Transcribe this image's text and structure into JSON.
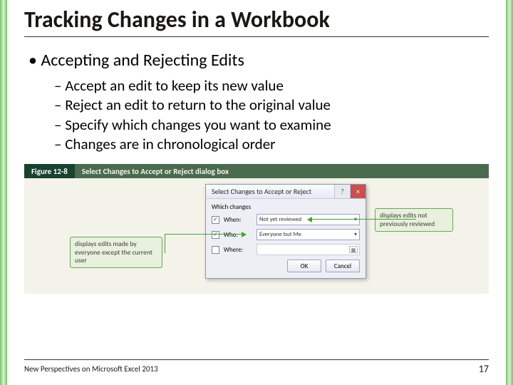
{
  "title": "Tracking Changes in a Workbook",
  "bullets": {
    "l1": "Accepting and Rejecting Edits",
    "l2a": "Accept an edit to keep its new value",
    "l2b": "Reject an edit to return to the original value",
    "l2c": "Specify which changes you want to examine",
    "l2d": "Changes are in chronological order"
  },
  "figure": {
    "num": "Figure 12-8",
    "caption": "Select Changes to Accept or Reject dialog box"
  },
  "dialog": {
    "title": "Select Changes to Accept or Reject",
    "help": "?",
    "close": "×",
    "which": "Which changes",
    "when_label": "When:",
    "when_value": "Not yet reviewed",
    "who_label": "Who:",
    "who_value": "Everyone but Me",
    "where_label": "Where:",
    "ok": "OK",
    "cancel": "Cancel"
  },
  "callouts": {
    "left": "displays edits made by everyone except the current user",
    "right": "displays edits not previously reviewed"
  },
  "footer": {
    "book": "New Perspectives on Microsoft Excel 2013",
    "page": "17"
  }
}
